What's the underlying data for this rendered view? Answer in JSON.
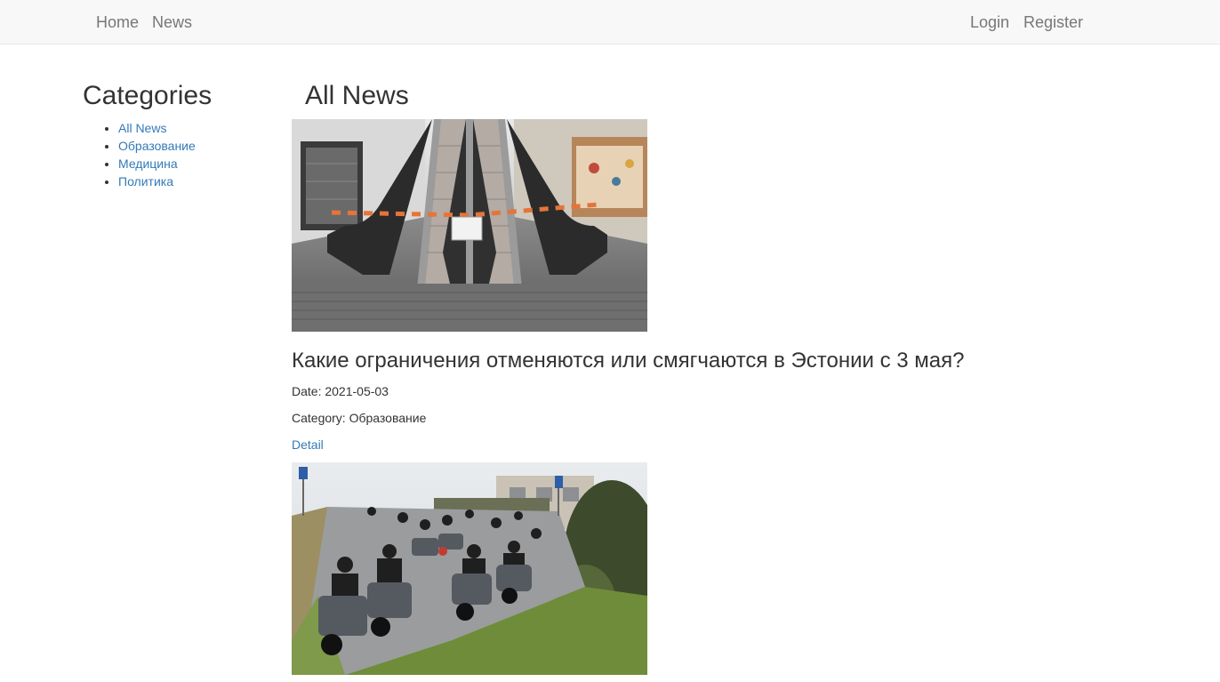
{
  "navbar": {
    "left_links": [
      "Home",
      "News"
    ],
    "right_links": [
      "Login",
      "Register"
    ]
  },
  "sidebar": {
    "title": "Categories",
    "items": [
      "All News",
      "Образование",
      "Медицина",
      "Политика"
    ]
  },
  "main": {
    "title": "All News",
    "articles": [
      {
        "title": "Какие ограничения отменяются или смягчаются в Эстонии с 3 мая?",
        "date_label": "Date: 2021-05-03",
        "category_label": "Category: Образование",
        "detail_label": "Detail",
        "image_icon": "escalator-photo"
      },
      {
        "image_icon": "motorcycles-photo"
      }
    ]
  },
  "colors": {
    "navbar_bg": "#f8f8f8",
    "link": "#337ab7",
    "nav_text": "#777777",
    "text": "#333333"
  }
}
